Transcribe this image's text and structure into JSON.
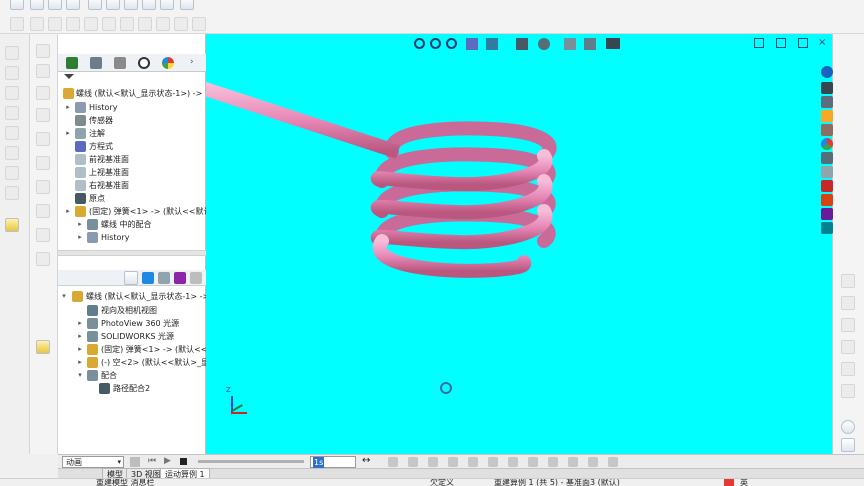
{
  "model_tree": {
    "root": "螺线 (默认<默认_显示状态-1>) ->",
    "items": [
      {
        "label": "History",
        "icon": "history-icon"
      },
      {
        "label": "传感器",
        "icon": "sensor-icon"
      },
      {
        "label": "注解",
        "icon": "annotation-icon"
      },
      {
        "label": "方程式",
        "icon": "equation-icon"
      },
      {
        "label": "前视基准面",
        "icon": "plane-icon"
      },
      {
        "label": "上视基准面",
        "icon": "plane-icon"
      },
      {
        "label": "右视基准面",
        "icon": "plane-icon"
      },
      {
        "label": "原点",
        "icon": "origin-icon"
      },
      {
        "label": "(固定) 弹簧<1> -> (默认<<默认",
        "icon": "part-icon"
      },
      {
        "label": "螺线 中的配合",
        "icon": "mates-icon"
      },
      {
        "label": "History",
        "icon": "history-icon"
      }
    ]
  },
  "display_tree": {
    "root": "螺线 (默认<默认_显示状态-1> ->",
    "items": [
      {
        "label": "视向及相机视图",
        "icon": "camera-icon"
      },
      {
        "label": "PhotoView 360 光源",
        "icon": "light-icon"
      },
      {
        "label": "SOLIDWORKS 光源",
        "icon": "light-icon"
      },
      {
        "label": "(固定) 弹簧<1> -> (默认<<默认",
        "icon": "part-icon"
      },
      {
        "label": "(-) 空<2> (默认<<默认>_显示状",
        "icon": "part-icon"
      },
      {
        "label": "配合",
        "icon": "mates-icon"
      },
      {
        "label": "路径配合2",
        "icon": "path-mate-icon"
      }
    ]
  },
  "motion": {
    "study_type": "动画",
    "frame_field": "1s"
  },
  "tabs": [
    {
      "label": "模型"
    },
    {
      "label": "3D 视图"
    },
    {
      "label": "运动算例 1"
    }
  ],
  "status": {
    "left": "重建模型   消息栏",
    "middle_left": "欠定义",
    "middle": "重建算例 1 (共 5) - 基准面3 (默认)",
    "ime": "英"
  },
  "viewport": {
    "background": "#00ffff",
    "spring_color": "#e889b8",
    "axis_label": "Z"
  }
}
